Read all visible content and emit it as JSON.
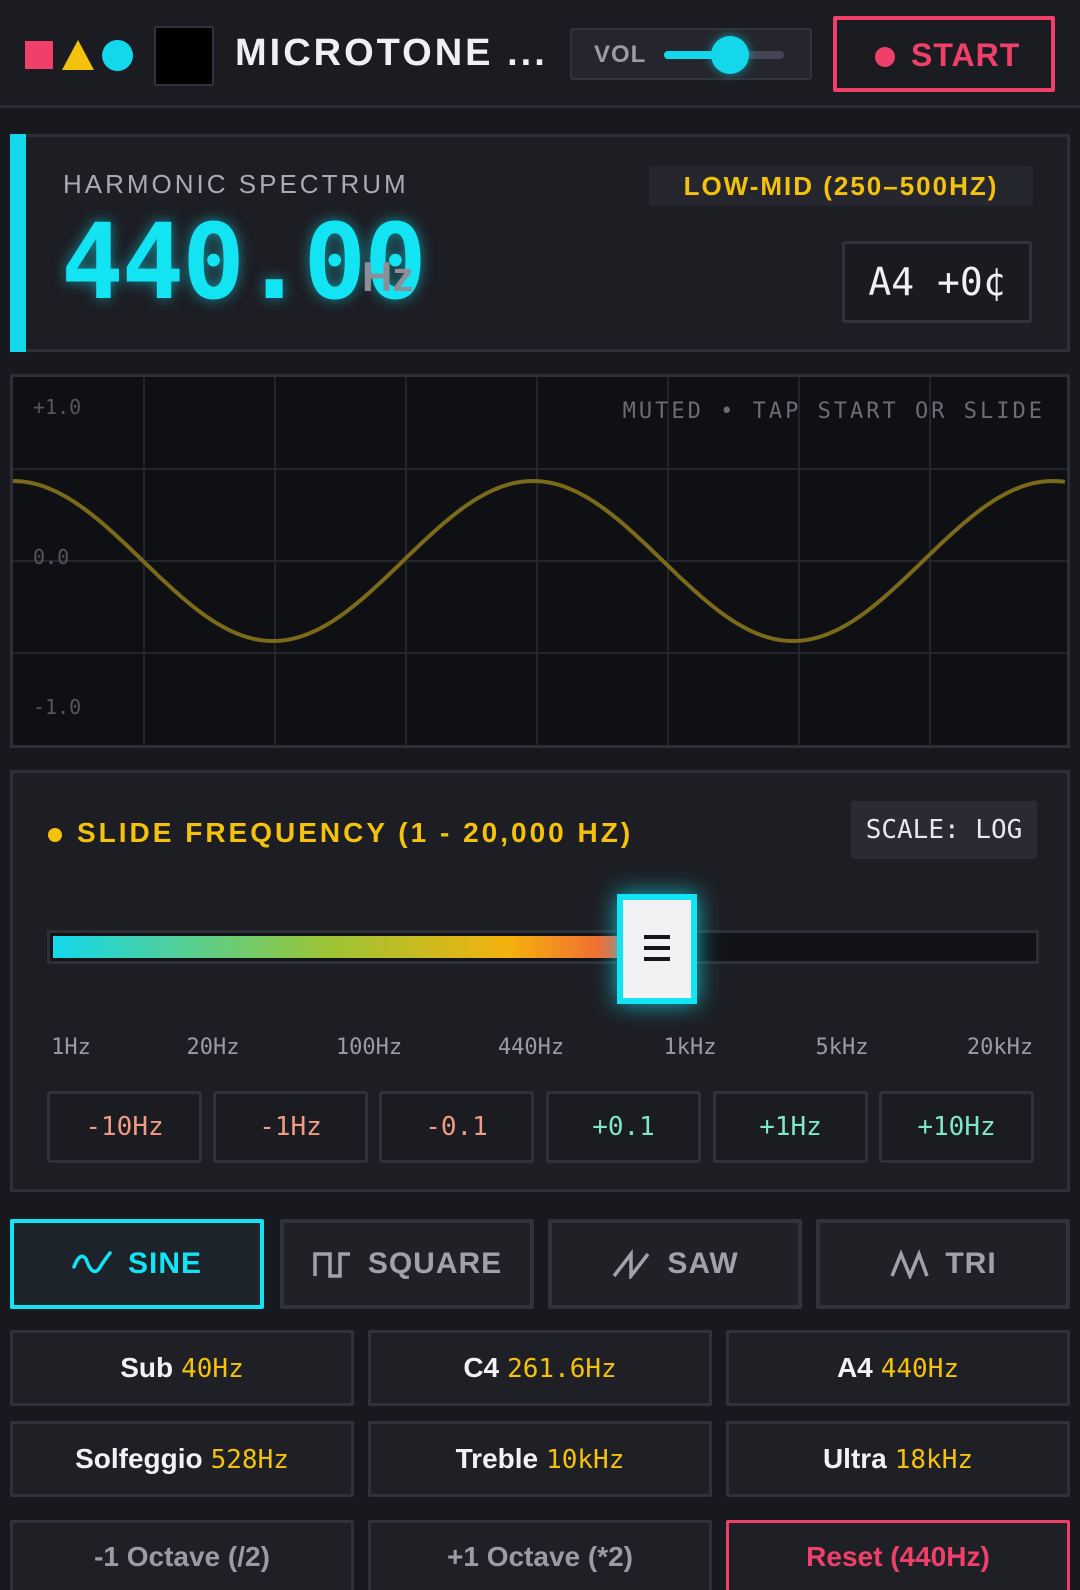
{
  "header": {
    "title": "MICROTONE ...",
    "vol_label": "VOL",
    "volume": 0.55,
    "start_label": "START"
  },
  "spectrum": {
    "label": "HARMONIC SPECTRUM",
    "frequency": "440.00",
    "unit": "Hz",
    "band": "LOW-MID (250–500HZ)",
    "note": "A4 +0¢"
  },
  "scope": {
    "status": "MUTED • TAP START OR SLIDE",
    "y_labels": [
      "+1.0",
      "0.0",
      "-1.0"
    ]
  },
  "slider": {
    "title": "SLIDE FREQUENCY (1 - 20,000 HZ)",
    "scale_label": "SCALE: LOG",
    "value_hz": 440,
    "min_hz": 1,
    "max_hz": 20000,
    "ticks": [
      "1Hz",
      "20Hz",
      "100Hz",
      "440Hz",
      "1kHz",
      "5kHz",
      "20kHz"
    ],
    "steps": [
      "-10Hz",
      "-1Hz",
      "-0.1",
      "+0.1",
      "+1Hz",
      "+10Hz"
    ]
  },
  "waveforms": [
    {
      "label": "SINE",
      "icon": "sine-wave-icon",
      "active": true
    },
    {
      "label": "SQUARE",
      "icon": "square-wave-icon",
      "active": false
    },
    {
      "label": "SAW",
      "icon": "saw-wave-icon",
      "active": false
    },
    {
      "label": "TRI",
      "icon": "triangle-wave-icon",
      "active": false
    }
  ],
  "presets": [
    {
      "name": "Sub",
      "freq": "40Hz"
    },
    {
      "name": "C4",
      "freq": "261.6Hz"
    },
    {
      "name": "A4",
      "freq": "440Hz"
    },
    {
      "name": "Solfeggio",
      "freq": "528Hz"
    },
    {
      "name": "Treble",
      "freq": "10kHz"
    },
    {
      "name": "Ultra",
      "freq": "18kHz"
    }
  ],
  "actions": {
    "octave_down": "-1 Octave (/2)",
    "octave_up": "+1 Octave (*2)",
    "reset": "Reset (440Hz)"
  },
  "colors": {
    "accent": "#13e4f4",
    "warning": "#f4c20d",
    "danger": "#f0406a",
    "wave": "#7a6a1a"
  }
}
